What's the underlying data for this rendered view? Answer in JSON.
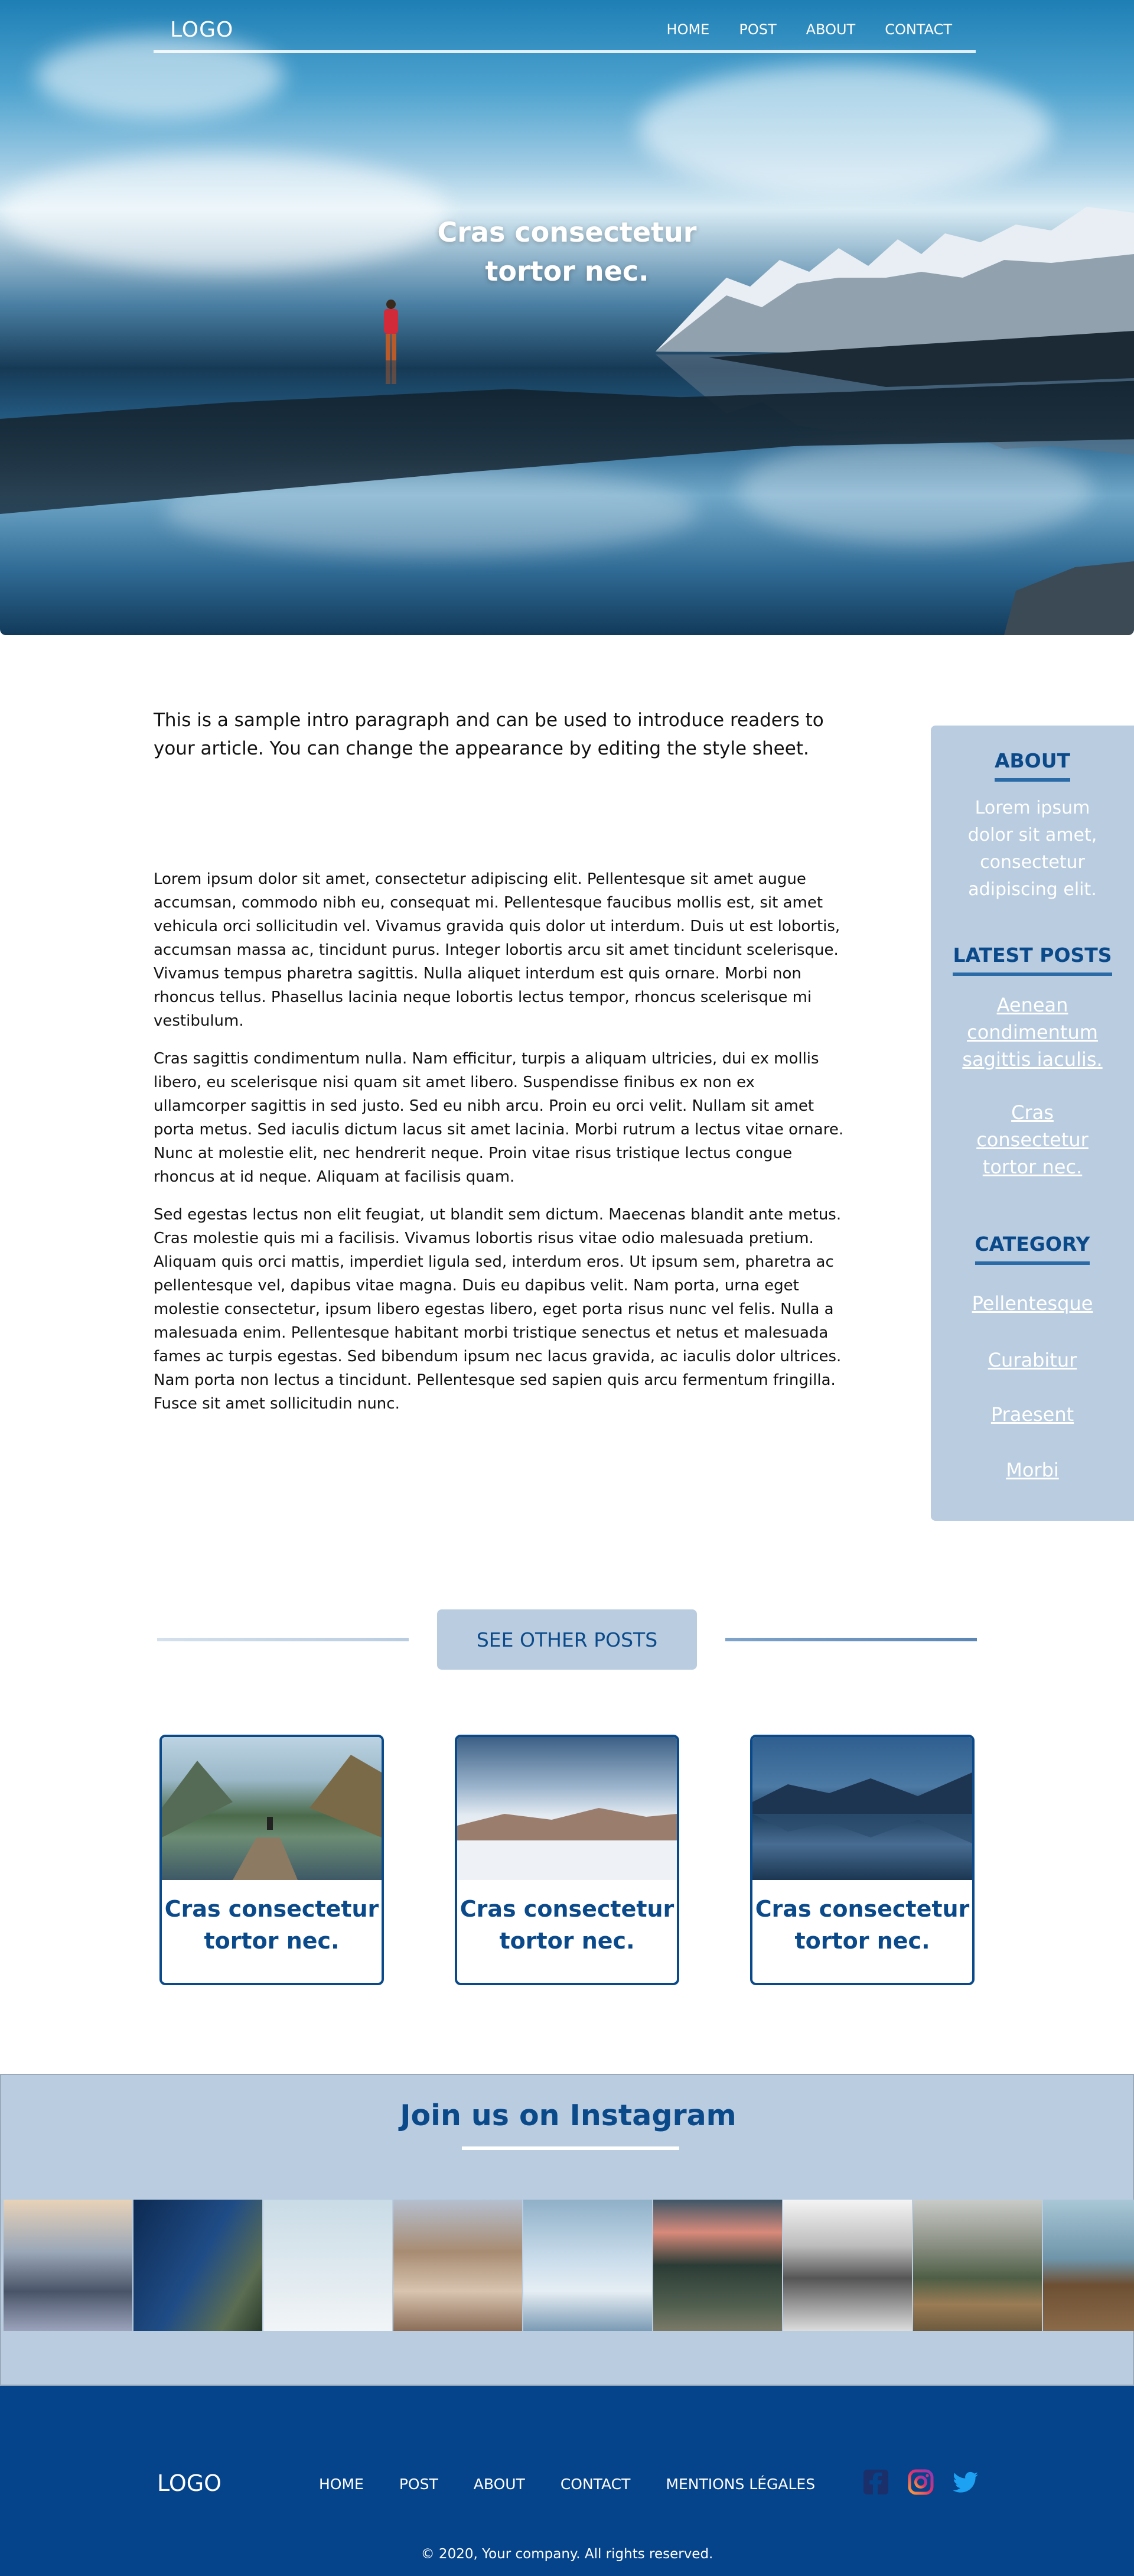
{
  "header": {
    "logo": "LOGO",
    "nav": [
      "HOME",
      "POST",
      "ABOUT",
      "CONTACT"
    ]
  },
  "hero": {
    "title_line1": "Cras consectetur",
    "title_line2": "tortor nec."
  },
  "article": {
    "intro": "This is a sample intro paragraph and can be used to introduce readers to your article. You can change the appearance by editing the style sheet.",
    "paragraphs": [
      "Lorem ipsum dolor sit amet, consectetur adipiscing elit. Pellentesque sit amet augue accumsan, commodo nibh eu, consequat mi. Pellentesque faucibus mollis est, sit amet vehicula orci sollicitudin vel. Vivamus gravida quis dolor ut interdum. Duis ut est lobortis, accumsan massa ac, tincidunt purus. Integer lobortis arcu sit amet tincidunt scelerisque. Vivamus tempus pharetra sagittis. Nulla aliquet interdum est quis ornare. Morbi non rhoncus tellus. Phasellus lacinia neque lobortis lectus tempor, rhoncus scelerisque mi vestibulum.",
      "Cras sagittis condimentum nulla. Nam efficitur, turpis a aliquam ultricies, dui ex mollis libero, eu scelerisque nisi quam sit amet libero. Suspendisse finibus ex non ex ullamcorper sagittis in sed justo. Sed eu nibh arcu. Proin eu orci velit. Nullam sit amet porta metus. Sed iaculis dictum lacus sit amet lacinia. Morbi rutrum a lectus vitae ornare. Nunc at molestie elit, nec hendrerit neque. Proin vitae risus tristique lectus congue rhoncus at id neque. Aliquam at facilisis quam.",
      "Sed egestas lectus non elit feugiat, ut blandit sem dictum. Maecenas blandit ante metus. Cras molestie quis mi a facilisis. Vivamus lobortis risus vitae odio malesuada pretium. Aliquam quis orci mattis, imperdiet ligula sed, interdum eros. Ut ipsum sem, pharetra ac pellentesque vel, dapibus vitae magna. Duis eu dapibus velit. Nam porta, urna eget molestie consectetur, ipsum libero egestas libero, eget porta risus nunc vel felis. Nulla a malesuada enim. Pellentesque habitant morbi tristique senectus et netus et malesuada fames ac turpis egestas. Sed bibendum ipsum nec lacus gravida, ac iaculis dolor ultrices. Nam porta non lectus a tincidunt. Pellentesque sed sapien quis arcu fermentum fringilla. Fusce sit amet sollicitudin nunc."
    ]
  },
  "sidebar": {
    "about_heading": "ABOUT",
    "about_text": "Lorem ipsum dolor sit amet, consectetur adipiscing elit.",
    "latest_heading": "LATEST POSTS",
    "latest_posts": [
      "Aenean condimentum sagittis iaculis.",
      "Cras consectetur tortor nec."
    ],
    "category_heading": "CATEGORY",
    "categories": [
      "Pellentesque",
      "Curabitur",
      "Praesent",
      "Morbi"
    ]
  },
  "other_posts": {
    "button_label": "SEE OTHER POSTS",
    "cards": [
      {
        "title": "Cras consectetur tortor nec."
      },
      {
        "title": "Cras consectetur tortor nec."
      },
      {
        "title": "Cras consectetur tortor nec."
      }
    ]
  },
  "instagram": {
    "title": "Join us on Instagram"
  },
  "footer": {
    "logo": "LOGO",
    "nav": [
      "HOME",
      "POST",
      "ABOUT",
      "CONTACT",
      "MENTIONS LÉGALES"
    ],
    "social_icons": [
      "facebook-icon",
      "instagram-icon",
      "twitter-icon"
    ],
    "copyright": "© 2020, Your company. All rights reserved."
  },
  "colors": {
    "brand_blue": "#0b4a8a",
    "panel_blue": "#b9cce0",
    "footer_blue": "#05438a"
  }
}
